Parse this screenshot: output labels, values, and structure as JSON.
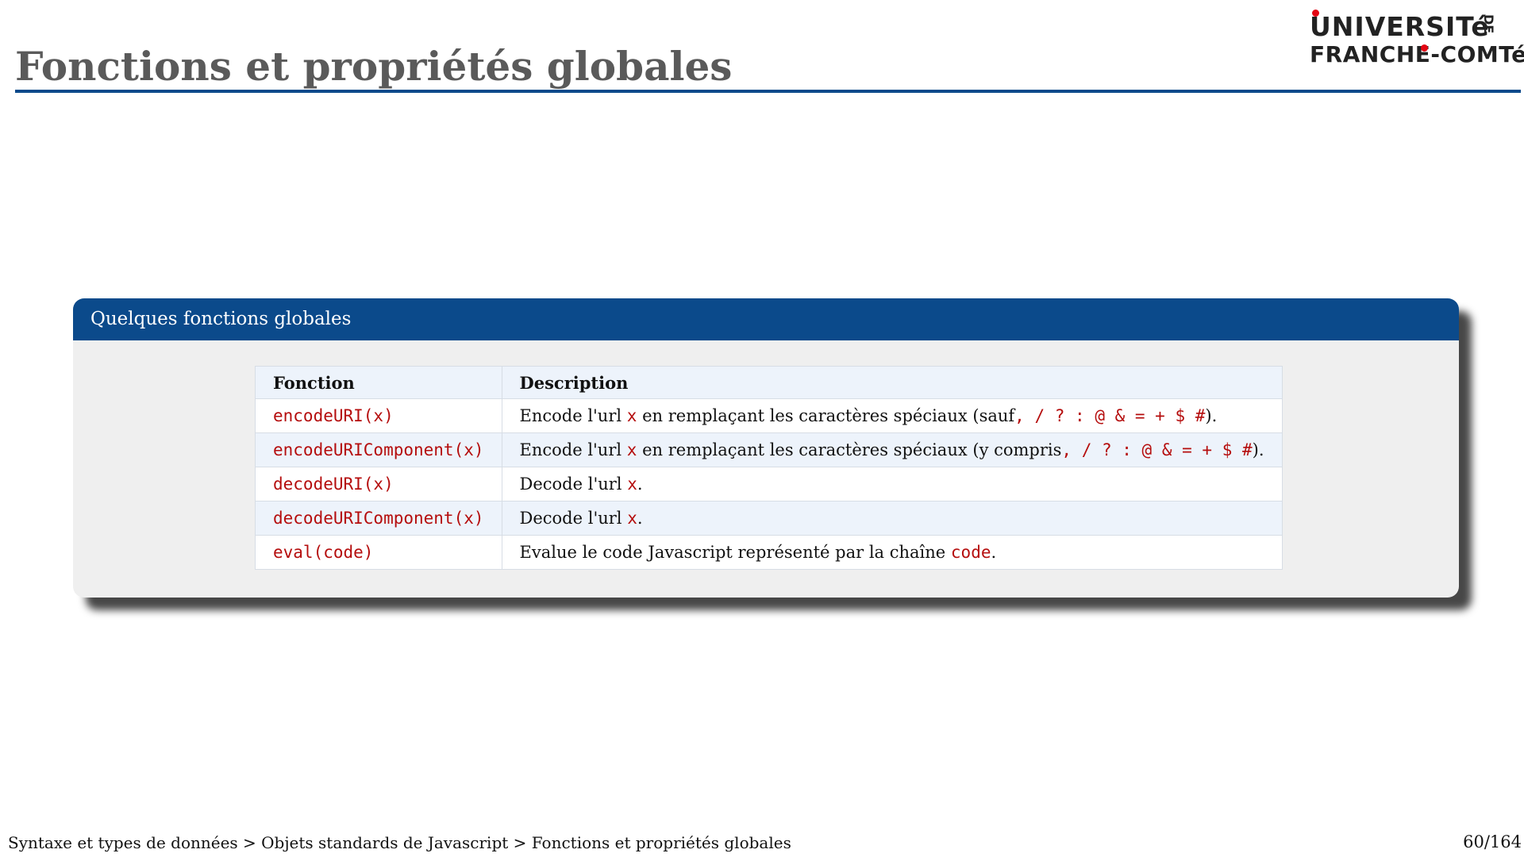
{
  "slide": {
    "title": "Fonctions et propriétés globales"
  },
  "logo": {
    "line1": "UNIVERSITé",
    "line2": "FRANCHE-COMTé",
    "de": "DE",
    "accent_color": "#e30613"
  },
  "block": {
    "title": "Quelques fonctions globales",
    "header_color": "#0b4a8b",
    "table": {
      "headers": [
        "Fonction",
        "Description"
      ],
      "rows": [
        {
          "function": "encodeURI(x)",
          "desc_before": "Encode l'url ",
          "desc_code": "x",
          "desc_middle": " en remplaçant les caractères spéciaux (sauf",
          "desc_code2": ", / ? : @ & = + $ #",
          "desc_after": ")."
        },
        {
          "function": "encodeURIComponent(x)",
          "desc_before": "Encode l'url ",
          "desc_code": "x",
          "desc_middle": " en remplaçant les caractères spéciaux (y compris",
          "desc_code2": ", / ? : @ & = + $ #",
          "desc_after": ")."
        },
        {
          "function": "decodeURI(x)",
          "desc_before": "Decode l'url ",
          "desc_code": "x",
          "desc_after": "."
        },
        {
          "function": "decodeURIComponent(x)",
          "desc_before": "Decode l'url ",
          "desc_code": "x",
          "desc_after": "."
        },
        {
          "function": "eval(code)",
          "desc_before": "Evalue le code Javascript représenté par la chaîne ",
          "desc_code": "code",
          "desc_after": "."
        }
      ]
    }
  },
  "footer": {
    "breadcrumb": "Syntaxe et types de données > Objets standards de Javascript > Fonctions et propriétés globales",
    "page": "60/164"
  }
}
